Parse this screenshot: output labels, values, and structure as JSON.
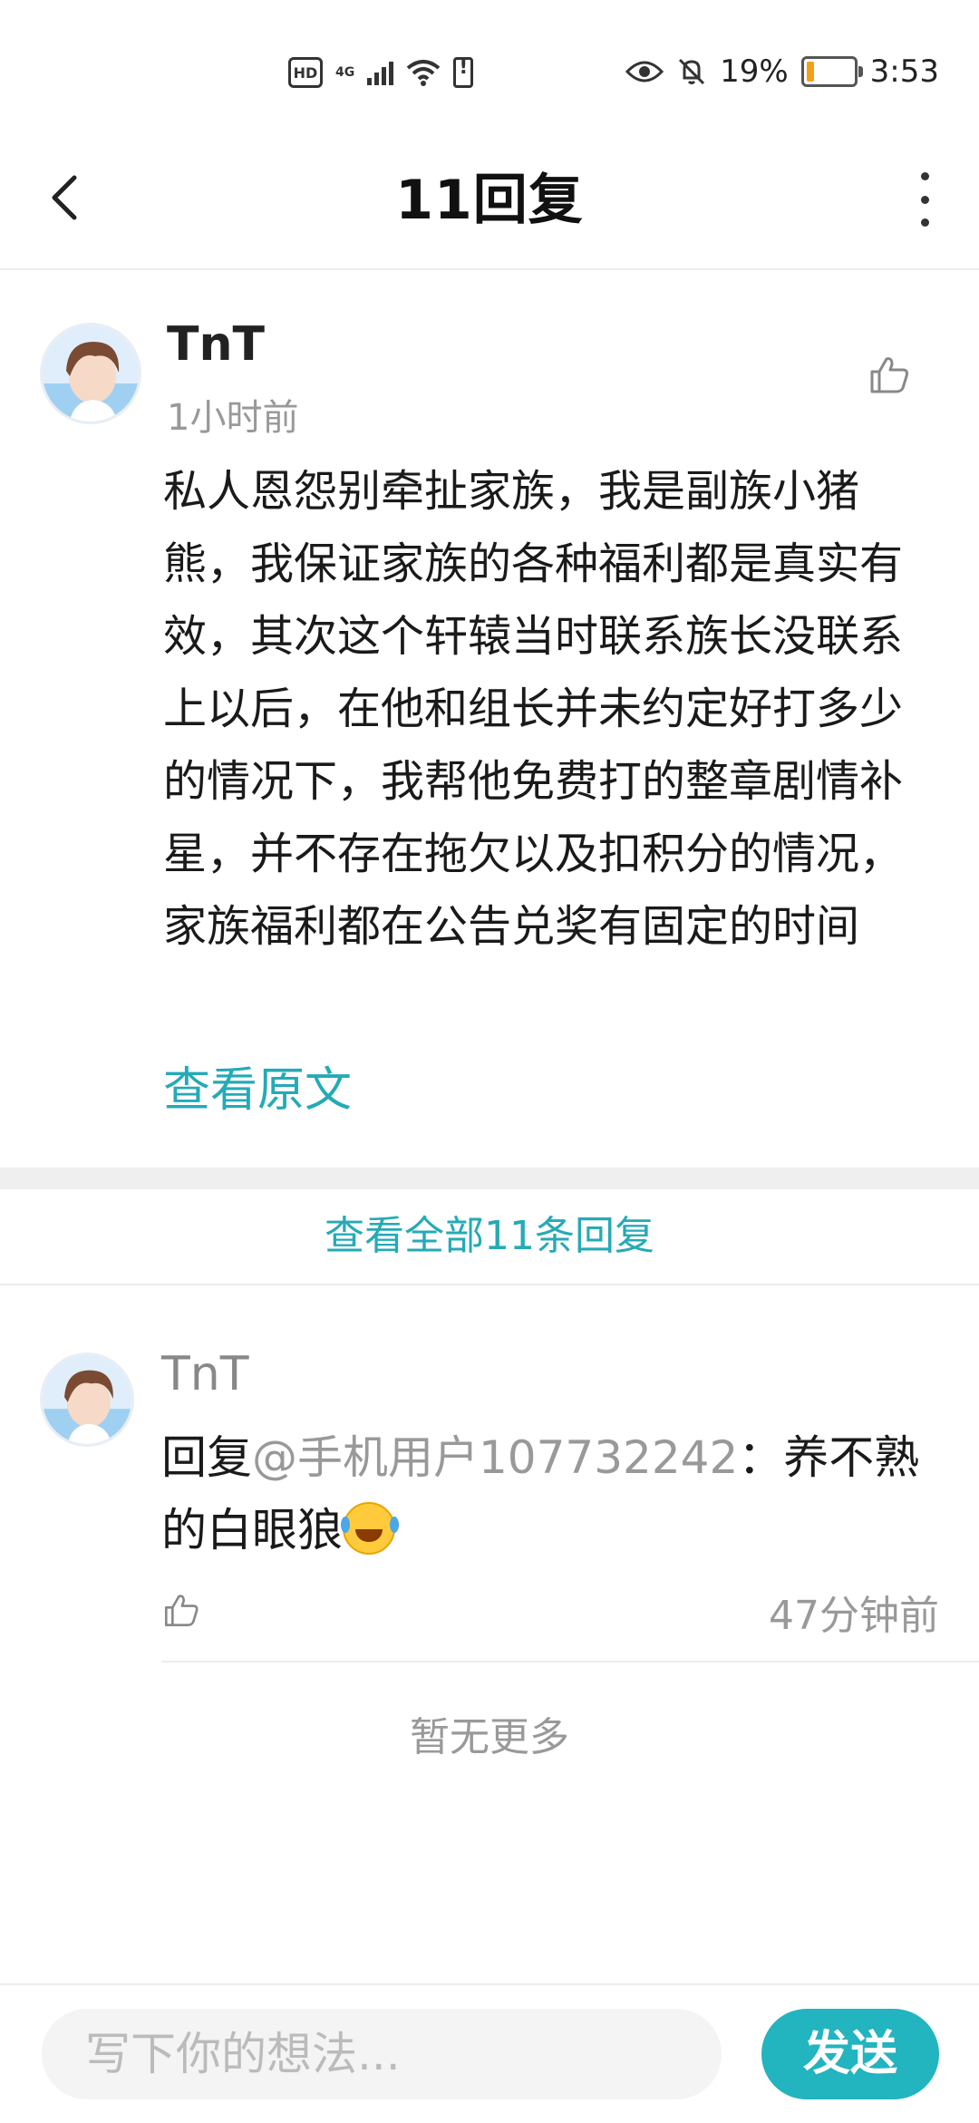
{
  "status_bar": {
    "hd": "HD",
    "network": "4G",
    "battery_percent": "19%",
    "battery_level": 0.19,
    "time": "3:53"
  },
  "header": {
    "title": "11回复"
  },
  "main_post": {
    "author": "TnT",
    "time": "1小时前",
    "content": "私人恩怨别牵扯家族，我是副族小猪熊，我保证家族的各种福利都是真实有效，其次这个轩辕当时联系族长没联系上以后，在他和组长并未约定好打多少的情况下，我帮他免费打的整章剧情补星，并不存在拖欠以及扣积分的情况，家族福利都在公告兑奖有固定的时间",
    "view_original": "查看原文"
  },
  "view_all": "查看全部11条回复",
  "reply": {
    "author": "TnT",
    "prefix": "回复",
    "mention": "@手机用户107732242",
    "text": "：养不熟的白眼狼",
    "time": "47分钟前"
  },
  "no_more": "暂无更多",
  "composer": {
    "placeholder": "写下你的想法...",
    "send_label": "发送"
  },
  "colors": {
    "accent": "#25aab6",
    "send_bg": "#22b4bf",
    "muted": "#999999"
  }
}
